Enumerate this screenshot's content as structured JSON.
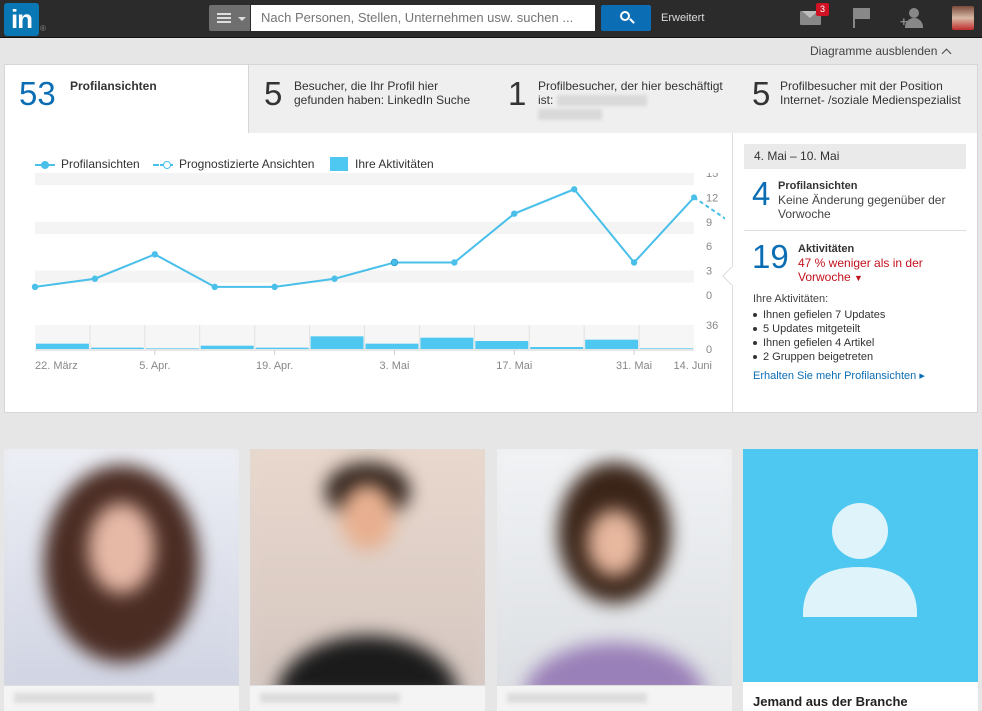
{
  "header": {
    "logo_text": "in",
    "logo_mark": "®",
    "search_placeholder": "Nach Personen, Stellen, Unternehmen usw. suchen ...",
    "advanced_label": "Erweitert",
    "messages_badge": "3",
    "icons": [
      "menu-icon",
      "search-icon",
      "mail-icon",
      "flag-icon",
      "add-connection-icon",
      "profile-avatar"
    ],
    "brand_color": "#0b6eb4"
  },
  "toggle_charts_label": "Diagramme ausblenden",
  "tabs": [
    {
      "number": "53",
      "label": "Profilansichten"
    },
    {
      "number": "5",
      "label": "Besucher, die Ihr Profil hier gefunden haben: LinkedIn Suche"
    },
    {
      "number": "1",
      "label": "Profilbesucher, der hier beschäftigt ist:"
    },
    {
      "number": "5",
      "label": "Profilbesucher mit der Position Internet- /soziale Medienspezialist"
    }
  ],
  "legend": {
    "views": "Profilansichten",
    "forecast": "Prognostizierte Ansichten",
    "activity": "Ihre Aktivitäten"
  },
  "chart_data": {
    "type": "line",
    "x_labels": [
      "22. März",
      "5. Apr.",
      "19. Apr.",
      "3. Mai",
      "17. Mai",
      "31. Mai",
      "14. Juni"
    ],
    "y_ticks": [
      0,
      3,
      6,
      9,
      12,
      15
    ],
    "ylim": [
      0,
      15
    ],
    "series": [
      {
        "name": "Profilansichten",
        "values": [
          1,
          2,
          5,
          1,
          1,
          2,
          4,
          4,
          10,
          13,
          4,
          12
        ],
        "color": "#49bfe9"
      },
      {
        "name": "Prognostizierte Ansichten",
        "from_index": 11,
        "values": [
          12,
          7
        ],
        "color": "#49bfe9",
        "dashed": true
      }
    ],
    "activity": {
      "name": "Ihre Aktivitäten",
      "values": [
        8,
        2,
        1,
        5,
        2,
        19,
        8,
        17,
        12,
        3,
        14,
        1
      ],
      "y_ticks": [
        0,
        36
      ],
      "ylim": [
        0,
        36
      ],
      "color": "#4ec8f0"
    }
  },
  "side": {
    "date_range": "4. Mai – 10. Mai",
    "views_count": "4",
    "views_title": "Profilansichten",
    "views_desc": "Keine Änderung gegenüber der Vorwoche",
    "acts_count": "19",
    "acts_title": "Aktivitäten",
    "acts_change": "47 % weniger als in der Vorwoche",
    "acts_list_title": "Ihre Aktivitäten:",
    "acts_list": [
      "Ihnen gefielen 7 Updates",
      "5 Updates mitgeteilt",
      "Ihnen gefielen 4 Artikel",
      "2 Gruppen beigetreten"
    ],
    "more_link": "Erhalten Sie mehr Profilansichten"
  },
  "viewer_card_caption": "Jemand aus der Branche"
}
